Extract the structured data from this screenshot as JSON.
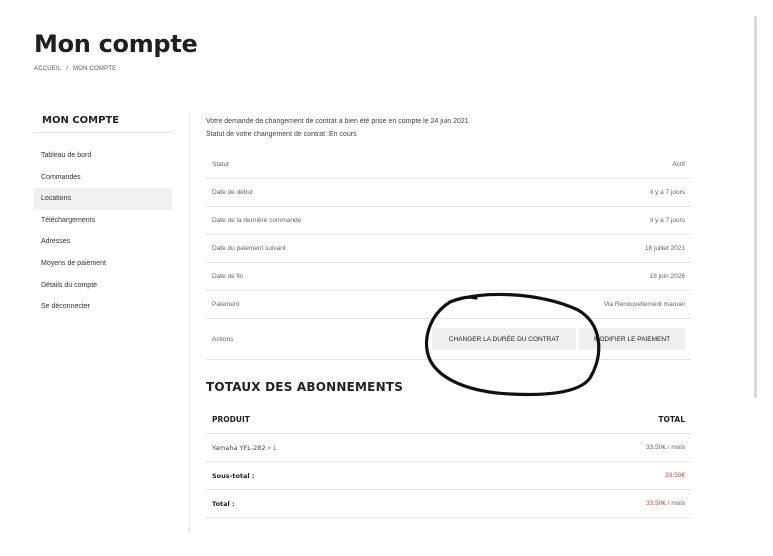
{
  "page": {
    "title": "Mon compte"
  },
  "breadcrumb": {
    "home": "ACCUEIL",
    "sep": "/",
    "current": "MON COMPTE"
  },
  "sidebar": {
    "title": "MON COMPTE",
    "items": [
      {
        "label": "Tableau de bord"
      },
      {
        "label": "Commandes"
      },
      {
        "label": "Locations"
      },
      {
        "label": "Téléchargements"
      },
      {
        "label": "Adresses"
      },
      {
        "label": "Moyens de paiement"
      },
      {
        "label": "Détails du compte"
      },
      {
        "label": "Se déconnecter"
      }
    ]
  },
  "notice": {
    "line1": "Votre demande de changement de contrat a bien été prise en compte le 24 juin 2021",
    "line2": "Statut de votre changement de contrat :En cours"
  },
  "subscription": {
    "rows": [
      {
        "label": "Statut",
        "value": "Actif"
      },
      {
        "label": "Date de début",
        "value": "Il y a 7 jours"
      },
      {
        "label": "Date de la dernière commande",
        "value": "Il y a 7 jours"
      },
      {
        "label": "Date du paiement suivant",
        "value": "18 juillet 2021"
      },
      {
        "label": "Date de fin",
        "value": "18 juin 2026"
      },
      {
        "label": "Paiement",
        "value": "Via Renouvellement manuel"
      }
    ],
    "actions_label": "Actions",
    "change_duration_button": "CHANGER LA DURÉE DU CONTRAT",
    "change_payment_button": "MODIFIER LE PAIEMENT"
  },
  "totals": {
    "title": "TOTAUX DES ABONNEMENTS",
    "col_product": "PRODUIT",
    "col_total": "TOTAL",
    "product_name": "Yamaha YFL-282",
    "product_qty": "× 1",
    "product_price": "33.50€",
    "per_month": "/ mois",
    "subtotal_label": "Sous-total :",
    "subtotal_value": "33.50€",
    "total_label": "Total :",
    "total_value": "33.50€"
  },
  "colors": {
    "price_red": "#e0452b",
    "active_bg": "#f0f0f0",
    "button_bg": "#efefef"
  }
}
